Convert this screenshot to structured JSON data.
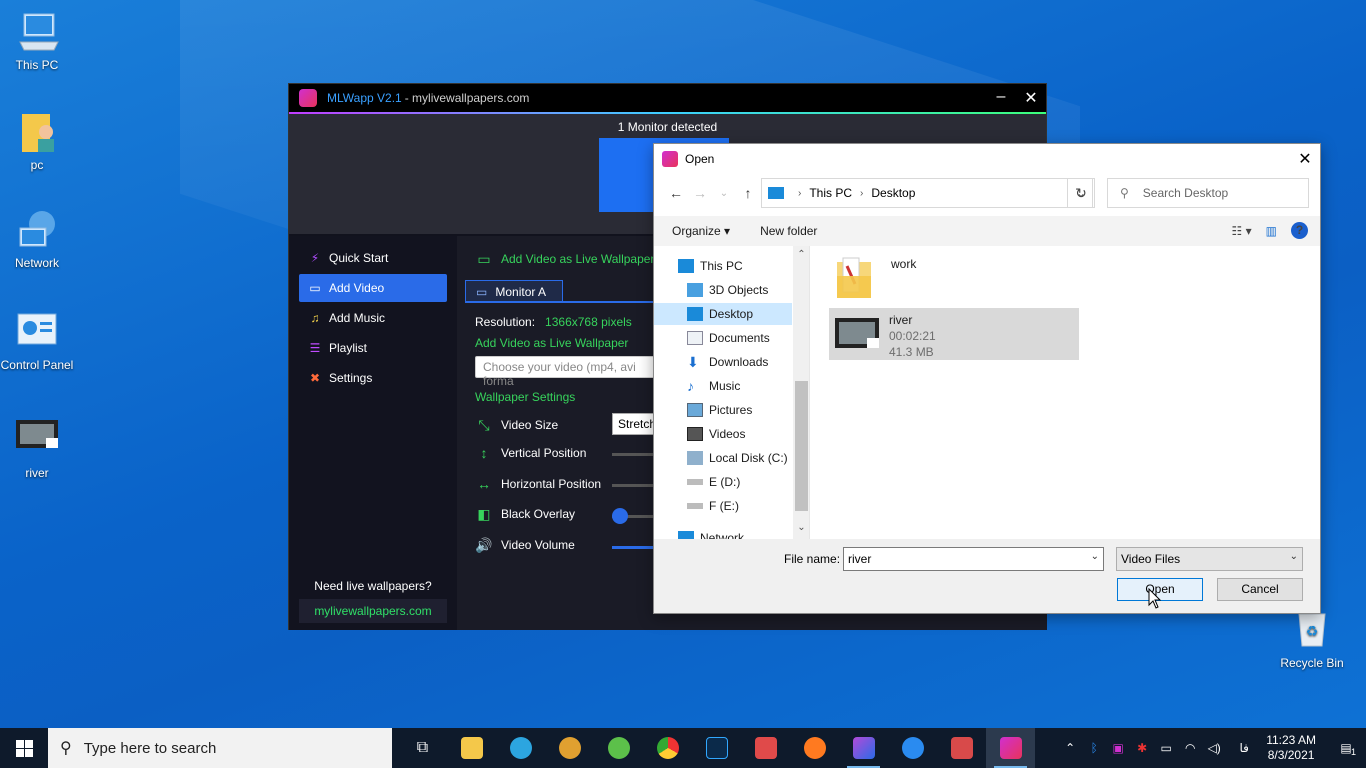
{
  "desktop": {
    "icons": [
      {
        "label": "This PC"
      },
      {
        "label": "pc"
      },
      {
        "label": "Network"
      },
      {
        "label": "Control Panel"
      },
      {
        "label": "river"
      },
      {
        "label": "Recycle Bin"
      }
    ]
  },
  "mlw": {
    "title": "MLWapp V2.1",
    "subtitle": " - mylivewallpapers.com",
    "monitor_detected": "1 Monitor detected",
    "sidebar": [
      {
        "label": "Quick Start"
      },
      {
        "label": "Add Video"
      },
      {
        "label": "Add Music"
      },
      {
        "label": "Playlist"
      },
      {
        "label": "Settings"
      }
    ],
    "need_text": "Need live wallpapers?",
    "site_link": "mylivewallpapers.com",
    "main": {
      "header": "Add Video as Live Wallpaper",
      "tab": "Monitor A",
      "resolution_label": "Resolution:",
      "resolution_value": "1366x768 pixels",
      "add_video_label": "Add Video as Live Wallpaper",
      "video_placeholder": "Choose your video (mp4, avi forma",
      "settings_label": "Wallpaper Settings",
      "settings": [
        {
          "label": "Video Size"
        },
        {
          "label": "Vertical Position"
        },
        {
          "label": "Horizontal Position"
        },
        {
          "label": "Black Overlay"
        },
        {
          "label": "Video Volume"
        }
      ],
      "video_size_value": "Stretch"
    }
  },
  "dialog": {
    "title": "Open",
    "breadcrumb": [
      "This PC",
      "Desktop"
    ],
    "search_placeholder": "Search Desktop",
    "toolbar": {
      "organize": "Organize",
      "new_folder": "New folder",
      "help": "?"
    },
    "tree": [
      {
        "label": "This PC"
      },
      {
        "label": "3D Objects"
      },
      {
        "label": "Desktop"
      },
      {
        "label": "Documents"
      },
      {
        "label": "Downloads"
      },
      {
        "label": "Music"
      },
      {
        "label": "Pictures"
      },
      {
        "label": "Videos"
      },
      {
        "label": "Local Disk (C:)"
      },
      {
        "label": "E (D:)"
      },
      {
        "label": "F (E:)"
      },
      {
        "label": "Network"
      }
    ],
    "files": [
      {
        "name": "work"
      },
      {
        "name": "river",
        "duration": "00:02:21",
        "size": "41.3 MB"
      }
    ],
    "file_name_label": "File name:",
    "file_name_value": "river",
    "file_type": "Video Files",
    "open_label": "Open",
    "cancel_label": "Cancel"
  },
  "taskbar": {
    "search_placeholder": "Type here to search",
    "lang": "فا",
    "time": "11:23 AM",
    "date": "8/3/2021",
    "notifications": "1"
  }
}
